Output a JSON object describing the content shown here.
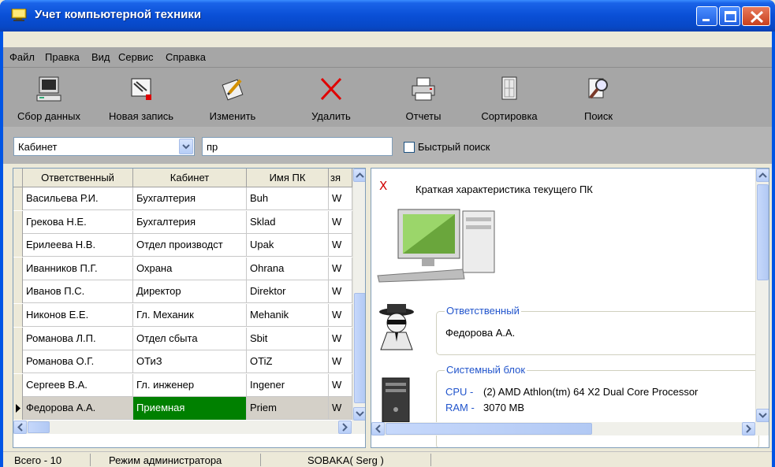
{
  "window": {
    "title": "Учет компьютерной техники"
  },
  "menu": [
    "Файл",
    "Правка",
    "Вид",
    "Сервис",
    "Справка"
  ],
  "toolbar": [
    {
      "label": "Сбор данных",
      "icon": "computer-icon"
    },
    {
      "label": "Новая запись",
      "icon": "new-record-icon"
    },
    {
      "label": "Изменить",
      "icon": "edit-icon"
    },
    {
      "label": "Удалить",
      "icon": "delete-icon"
    },
    {
      "label": "Отчеты",
      "icon": "printer-icon"
    },
    {
      "label": "Сортировка",
      "icon": "sort-icon"
    },
    {
      "label": "Поиск",
      "icon": "search-icon"
    }
  ],
  "filter": {
    "field": "Кабинет",
    "query": "пр",
    "quick_search_label": "Быстрый поиск",
    "quick_search_checked": false
  },
  "grid": {
    "columns": [
      "Ответственный",
      "Кабинет",
      "Имя ПК",
      "зя"
    ],
    "rows": [
      [
        "Васильева Р.И.",
        "Бухгалтерия",
        "Buh",
        "W"
      ],
      [
        "Грекова Н.Е.",
        "Бухгалтерия",
        "Sklad",
        "W"
      ],
      [
        "Ерилеева Н.В.",
        "Отдел производст",
        "Upak",
        "W"
      ],
      [
        "Иванников П.Г.",
        "Охрана",
        "Ohrana",
        "W"
      ],
      [
        "Иванов П.С.",
        "Директор",
        "Direktor",
        "W"
      ],
      [
        "Никонов Е.Е.",
        "Гл. Механик",
        "Mehanik",
        "W"
      ],
      [
        "Романова Л.П.",
        "Отдел сбыта",
        "Sbit",
        "W"
      ],
      [
        "Романова О.Г.",
        "ОТиЗ",
        "OTiZ",
        "W"
      ],
      [
        "Сергеев В.А.",
        "Гл. инженер",
        "Ingener",
        "W"
      ],
      [
        "Федорова А.А.",
        "Приемная",
        "Priem",
        "W"
      ]
    ],
    "selected_row": 9
  },
  "details": {
    "title": "Краткая характеристика текущего ПК",
    "close": "X",
    "responsible": {
      "legend": "Ответственный",
      "value": "Федорова А.А."
    },
    "system_unit": {
      "legend": "Системный блок",
      "cpu_label": "CPU -",
      "cpu_value": "(2) AMD Athlon(tm) 64 X2 Dual Core Processor",
      "ram_label": "RAM -",
      "ram_value": "3070 MB"
    }
  },
  "status": {
    "total": "Всего - 10",
    "mode": "Режим администратора",
    "host": "SOBAKA( Serg )"
  },
  "colors": {
    "title_bar": "#0a4fd6",
    "toolbar_bg": "#a6a6a6",
    "selected_cell": "#008000",
    "accent_text": "#2255cc",
    "close_x": "#d00000"
  }
}
